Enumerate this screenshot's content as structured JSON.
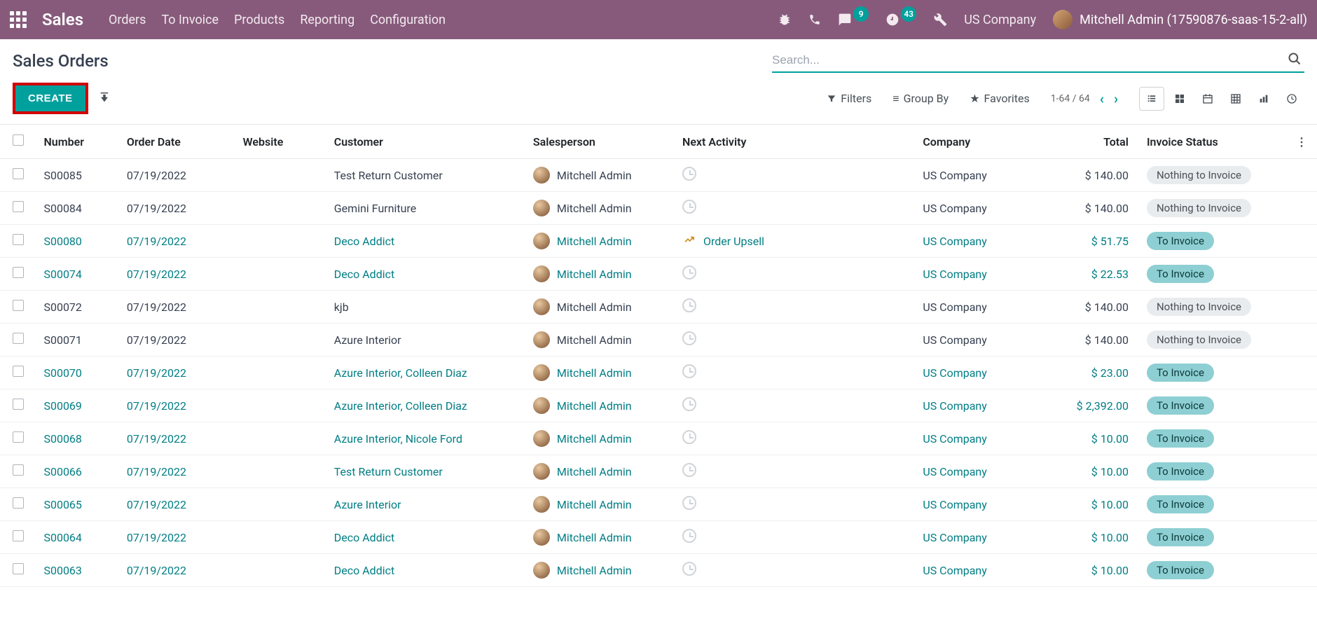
{
  "nav": {
    "brand": "Sales",
    "items": [
      "Orders",
      "To Invoice",
      "Products",
      "Reporting",
      "Configuration"
    ],
    "msg_count": "9",
    "activity_count": "43",
    "company": "US Company",
    "user": "Mitchell Admin (17590876-saas-15-2-all)"
  },
  "header": {
    "title": "Sales Orders",
    "search_placeholder": "Search..."
  },
  "controls": {
    "create": "CREATE",
    "filters": "Filters",
    "groupby": "Group By",
    "favorites": "Favorites",
    "pager": "1-64 / 64"
  },
  "table": {
    "headers": {
      "number": "Number",
      "order_date": "Order Date",
      "website": "Website",
      "customer": "Customer",
      "salesperson": "Salesperson",
      "next_activity": "Next Activity",
      "company": "Company",
      "total": "Total",
      "invoice_status": "Invoice Status"
    },
    "rows": [
      {
        "number": "S00085",
        "date": "07/19/2022",
        "website": "",
        "customer": "Test Return Customer",
        "salesperson": "Mitchell Admin",
        "activity": "",
        "activity_icon": "clock",
        "company": "US Company",
        "total": "$ 140.00",
        "status": "Nothing to Invoice",
        "status_kind": "nothing",
        "linked": false
      },
      {
        "number": "S00084",
        "date": "07/19/2022",
        "website": "",
        "customer": "Gemini Furniture",
        "salesperson": "Mitchell Admin",
        "activity": "",
        "activity_icon": "clock",
        "company": "US Company",
        "total": "$ 140.00",
        "status": "Nothing to Invoice",
        "status_kind": "nothing",
        "linked": false
      },
      {
        "number": "S00080",
        "date": "07/19/2022",
        "website": "",
        "customer": "Deco Addict",
        "salesperson": "Mitchell Admin",
        "activity": "Order Upsell",
        "activity_icon": "chart",
        "company": "US Company",
        "total": "$ 51.75",
        "status": "To Invoice",
        "status_kind": "to_invoice",
        "linked": true
      },
      {
        "number": "S00074",
        "date": "07/19/2022",
        "website": "",
        "customer": "Deco Addict",
        "salesperson": "Mitchell Admin",
        "activity": "",
        "activity_icon": "clock",
        "company": "US Company",
        "total": "$ 22.53",
        "status": "To Invoice",
        "status_kind": "to_invoice",
        "linked": true
      },
      {
        "number": "S00072",
        "date": "07/19/2022",
        "website": "",
        "customer": "kjb",
        "salesperson": "Mitchell Admin",
        "activity": "",
        "activity_icon": "clock",
        "company": "US Company",
        "total": "$ 140.00",
        "status": "Nothing to Invoice",
        "status_kind": "nothing",
        "linked": false
      },
      {
        "number": "S00071",
        "date": "07/19/2022",
        "website": "",
        "customer": "Azure Interior",
        "salesperson": "Mitchell Admin",
        "activity": "",
        "activity_icon": "clock",
        "company": "US Company",
        "total": "$ 140.00",
        "status": "Nothing to Invoice",
        "status_kind": "nothing",
        "linked": false
      },
      {
        "number": "S00070",
        "date": "07/19/2022",
        "website": "",
        "customer": "Azure Interior, Colleen Diaz",
        "salesperson": "Mitchell Admin",
        "activity": "",
        "activity_icon": "clock",
        "company": "US Company",
        "total": "$ 23.00",
        "status": "To Invoice",
        "status_kind": "to_invoice",
        "linked": true
      },
      {
        "number": "S00069",
        "date": "07/19/2022",
        "website": "",
        "customer": "Azure Interior, Colleen Diaz",
        "salesperson": "Mitchell Admin",
        "activity": "",
        "activity_icon": "clock",
        "company": "US Company",
        "total": "$ 2,392.00",
        "status": "To Invoice",
        "status_kind": "to_invoice",
        "linked": true
      },
      {
        "number": "S00068",
        "date": "07/19/2022",
        "website": "",
        "customer": "Azure Interior, Nicole Ford",
        "salesperson": "Mitchell Admin",
        "activity": "",
        "activity_icon": "clock",
        "company": "US Company",
        "total": "$ 10.00",
        "status": "To Invoice",
        "status_kind": "to_invoice",
        "linked": true
      },
      {
        "number": "S00066",
        "date": "07/19/2022",
        "website": "",
        "customer": "Test Return Customer",
        "salesperson": "Mitchell Admin",
        "activity": "",
        "activity_icon": "clock",
        "company": "US Company",
        "total": "$ 10.00",
        "status": "To Invoice",
        "status_kind": "to_invoice",
        "linked": true
      },
      {
        "number": "S00065",
        "date": "07/19/2022",
        "website": "",
        "customer": "Azure Interior",
        "salesperson": "Mitchell Admin",
        "activity": "",
        "activity_icon": "clock",
        "company": "US Company",
        "total": "$ 10.00",
        "status": "To Invoice",
        "status_kind": "to_invoice",
        "linked": true
      },
      {
        "number": "S00064",
        "date": "07/19/2022",
        "website": "",
        "customer": "Deco Addict",
        "salesperson": "Mitchell Admin",
        "activity": "",
        "activity_icon": "clock",
        "company": "US Company",
        "total": "$ 10.00",
        "status": "To Invoice",
        "status_kind": "to_invoice",
        "linked": true
      },
      {
        "number": "S00063",
        "date": "07/19/2022",
        "website": "",
        "customer": "Deco Addict",
        "salesperson": "Mitchell Admin",
        "activity": "",
        "activity_icon": "clock",
        "company": "US Company",
        "total": "$ 10.00",
        "status": "To Invoice",
        "status_kind": "to_invoice",
        "linked": true
      }
    ]
  }
}
